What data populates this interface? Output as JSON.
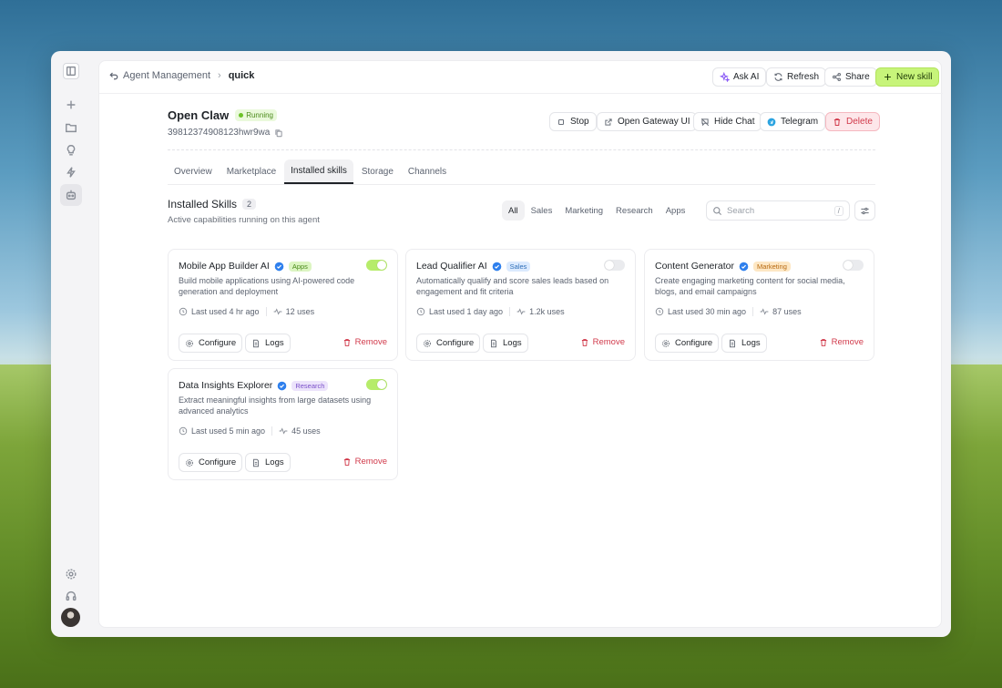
{
  "breadcrumb": {
    "parent": "Agent Management",
    "current": "quick"
  },
  "toolbar": {
    "ask_ai": "Ask AI",
    "refresh": "Refresh",
    "share": "Share",
    "new_skill": "New skill"
  },
  "agent": {
    "name": "Open Claw",
    "status": "Running",
    "id": "39812374908123hwr9wa"
  },
  "actions": {
    "stop": "Stop",
    "gateway": "Open Gateway UI",
    "hide_chat": "Hide Chat",
    "telegram": "Telegram",
    "delete": "Delete"
  },
  "tabs": [
    "Overview",
    "Marketplace",
    "Installed skills",
    "Storage",
    "Channels"
  ],
  "active_tab": "Installed skills",
  "section": {
    "title": "Installed Skills",
    "count": "2",
    "subtitle": "Active capabilities running on this agent"
  },
  "filters": [
    "All",
    "Sales",
    "Marketing",
    "Research",
    "Apps"
  ],
  "active_filter": "All",
  "search": {
    "placeholder": "Search",
    "shortcut": "/"
  },
  "card_labels": {
    "configure": "Configure",
    "logs": "Logs",
    "remove": "Remove"
  },
  "skills": [
    {
      "name": "Mobile App Builder AI",
      "tag": "Apps",
      "enabled": true,
      "description": "Build mobile applications using AI-powered code generation and deployment",
      "last_used": "Last used 4 hr ago",
      "uses": "12 uses"
    },
    {
      "name": "Lead Qualifier AI",
      "tag": "Sales",
      "enabled": false,
      "description": "Automatically qualify and score sales leads based on engagement and fit criteria",
      "last_used": "Last used 1 day ago",
      "uses": "1.2k uses"
    },
    {
      "name": "Content Generator",
      "tag": "Marketing",
      "enabled": false,
      "description": "Create engaging marketing content for social media, blogs, and email campaigns",
      "last_used": "Last used 30 min ago",
      "uses": "87 uses"
    },
    {
      "name": "Data Insights Explorer",
      "tag": "Research",
      "enabled": true,
      "description": "Extract meaningful insights from large datasets using advanced analytics",
      "last_used": "Last used 5 min ago",
      "uses": "45 uses"
    }
  ],
  "colors": {
    "accent": "#c7f47a",
    "danger": "#d13a4b",
    "verify": "#2f80ed",
    "tag_apps": "#dcf5c2",
    "tag_sales": "#dbeafe",
    "tag_marketing": "#fde7c4",
    "tag_research": "#ece3fb"
  }
}
